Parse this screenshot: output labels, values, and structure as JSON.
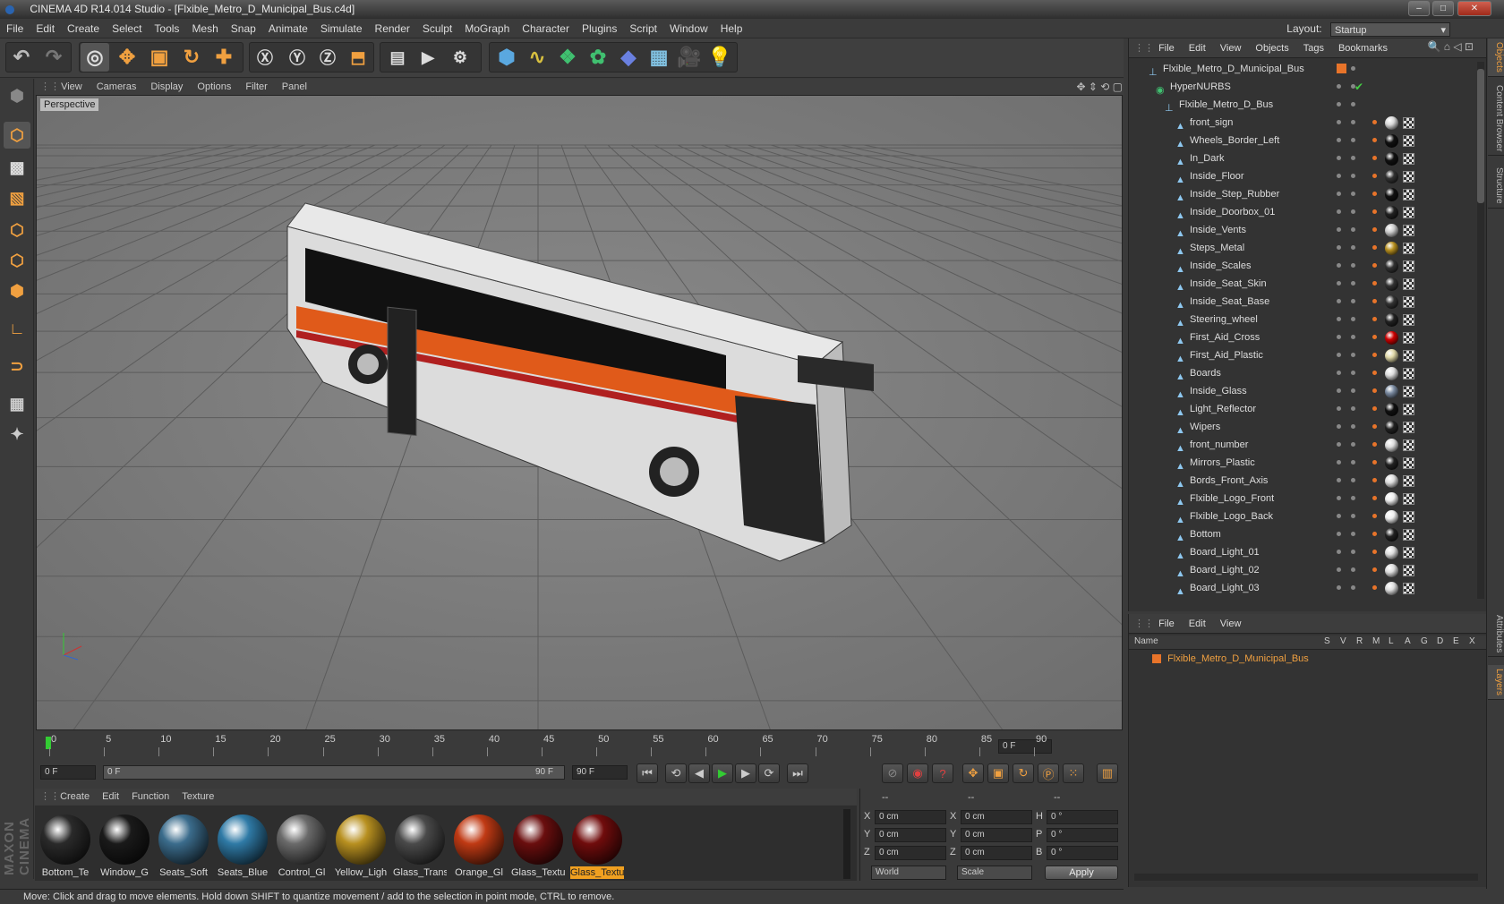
{
  "window": {
    "title": "CINEMA 4D R14.014 Studio - [Flxible_Metro_D_Municipal_Bus.c4d]",
    "minimize": "–",
    "maximize": "□",
    "close": "✕"
  },
  "menu": [
    "File",
    "Edit",
    "Create",
    "Select",
    "Tools",
    "Mesh",
    "Snap",
    "Animate",
    "Simulate",
    "Render",
    "Sculpt",
    "MoGraph",
    "Character",
    "Plugins",
    "Script",
    "Window",
    "Help"
  ],
  "layout": {
    "label": "Layout:",
    "value": "Startup"
  },
  "viewport": {
    "menu": [
      "View",
      "Cameras",
      "Display",
      "Options",
      "Filter",
      "Panel"
    ],
    "label": "Perspective"
  },
  "timeline": {
    "ticks": [
      "0",
      "5",
      "10",
      "15",
      "20",
      "25",
      "30",
      "35",
      "40",
      "45",
      "50",
      "55",
      "60",
      "65",
      "70",
      "75",
      "80",
      "85",
      "90"
    ],
    "current_frame": "0 F",
    "start_frame": "0 F",
    "range_start": "0 F",
    "range_end": "90 F",
    "end_frame": "90 F"
  },
  "materials": {
    "menu": [
      "Create",
      "Edit",
      "Function",
      "Texture"
    ],
    "items": [
      {
        "label": "Bottom_Te",
        "color": "#2a2a2a"
      },
      {
        "label": "Window_G",
        "color": "#1a1a1a"
      },
      {
        "label": "Seats_Soft",
        "color": "#3b6c8c"
      },
      {
        "label": "Seats_Blue",
        "color": "#2f7aa6"
      },
      {
        "label": "Control_Gl",
        "color": "#6a6a6a"
      },
      {
        "label": "Yellow_Ligh",
        "color": "#b89020"
      },
      {
        "label": "Glass_Trans",
        "color": "#4a4a4a"
      },
      {
        "label": "Orange_Gl",
        "color": "#c03a14"
      },
      {
        "label": "Glass_Textu",
        "color": "#6a0e0e"
      },
      {
        "label": "Glass_Textu",
        "color": "#700c0c"
      }
    ]
  },
  "coords": {
    "headers": [
      "--",
      "--",
      "--"
    ],
    "rows": [
      {
        "a": "X",
        "av": "0 cm",
        "b": "X",
        "bv": "0 cm",
        "c": "H",
        "cv": "0 °"
      },
      {
        "a": "Y",
        "av": "0 cm",
        "b": "Y",
        "bv": "0 cm",
        "c": "P",
        "cv": "0 °"
      },
      {
        "a": "Z",
        "av": "0 cm",
        "b": "Z",
        "bv": "0 cm",
        "c": "B",
        "cv": "0 °"
      }
    ],
    "mode": "World",
    "scale": "Scale",
    "apply": "Apply"
  },
  "status": "Move: Click and drag to move elements. Hold down SHIFT to quantize movement / add to the selection in point mode, CTRL to remove.",
  "objects": {
    "menu": [
      "File",
      "Edit",
      "View",
      "Objects",
      "Tags",
      "Bookmarks"
    ],
    "root": "Flxible_Metro_D_Municipal_Bus",
    "hypernurbs": "HyperNURBS",
    "group": "Flxible_Metro_D_Bus",
    "items": [
      {
        "name": "front_sign",
        "mat": "#d8d8d8"
      },
      {
        "name": "Wheels_Border_Left",
        "mat": "#111111"
      },
      {
        "name": "In_Dark",
        "mat": "#111111"
      },
      {
        "name": "Inside_Floor",
        "mat": "#333333"
      },
      {
        "name": "Inside_Step_Rubber",
        "mat": "#111111"
      },
      {
        "name": "Inside_Doorbox_01",
        "mat": "#222222"
      },
      {
        "name": "Inside_Vents",
        "mat": "#cccccc"
      },
      {
        "name": "Steps_Metal",
        "mat": "#b89020"
      },
      {
        "name": "Inside_Scales",
        "mat": "#333333"
      },
      {
        "name": "Inside_Seat_Skin",
        "mat": "#333333"
      },
      {
        "name": "Inside_Seat_Base",
        "mat": "#333333"
      },
      {
        "name": "Steering_wheel",
        "mat": "#222222"
      },
      {
        "name": "First_Aid_Cross",
        "mat": "#cc0000"
      },
      {
        "name": "First_Aid_Plastic",
        "mat": "#e0d8a8"
      },
      {
        "name": "Boards",
        "mat": "#dddddd"
      },
      {
        "name": "Inside_Glass",
        "mat": "#7a8aa0"
      },
      {
        "name": "Light_Reflector",
        "mat": "#111111"
      },
      {
        "name": "Wipers",
        "mat": "#222222"
      },
      {
        "name": "front_number",
        "mat": "#dddddd"
      },
      {
        "name": "Mirrors_Plastic",
        "mat": "#222222"
      },
      {
        "name": "Bords_Front_Axis",
        "mat": "#dddddd"
      },
      {
        "name": "Flxible_Logo_Front",
        "mat": "#eeeeee"
      },
      {
        "name": "Flxible_Logo_Back",
        "mat": "#eeeeee"
      },
      {
        "name": "Bottom",
        "mat": "#222222"
      },
      {
        "name": "Board_Light_01",
        "mat": "#dddddd"
      },
      {
        "name": "Board_Light_02",
        "mat": "#dddddd"
      },
      {
        "name": "Board_Light_03",
        "mat": "#dddddd"
      }
    ]
  },
  "layers": {
    "menu": [
      "File",
      "Edit",
      "View"
    ],
    "columns": [
      "Name",
      "S",
      "V",
      "R",
      "M",
      "L",
      "A",
      "G",
      "D",
      "E",
      "X"
    ],
    "row": "Flxible_Metro_D_Municipal_Bus"
  },
  "side_tabs": [
    "Objects",
    "Content Browser",
    "Structure",
    "Attributes",
    "Layers"
  ],
  "logo": "MAXON CINEMA 4D",
  "accent": "#e8742a"
}
